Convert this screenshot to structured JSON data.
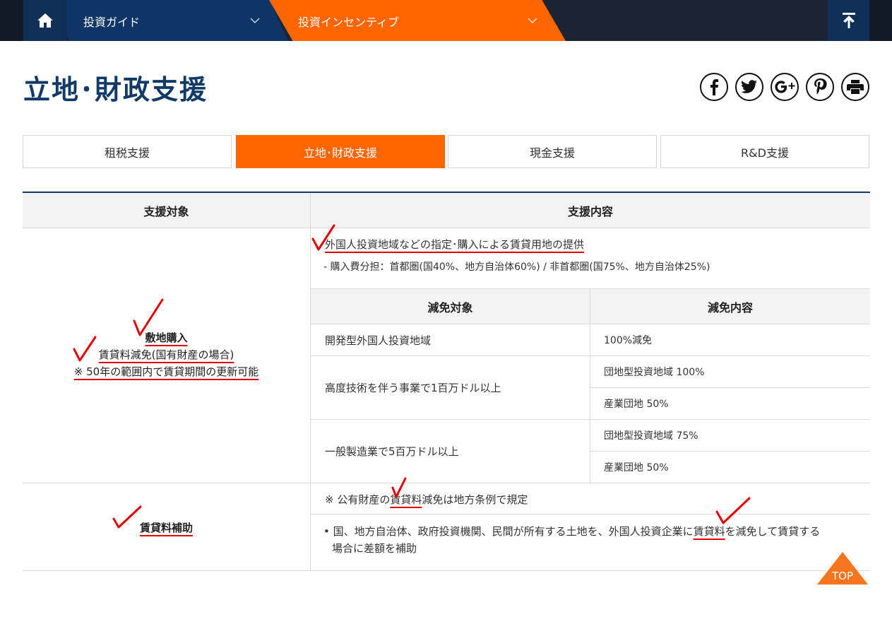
{
  "nav": {
    "guide_label": "投資ガイド",
    "incentive_label": "投資インセンティブ",
    "home_icon": "home-icon",
    "up_icon": "arrow-up-icon",
    "colors": {
      "dark": "#1b2433",
      "navy": "#0e3565",
      "accent": "#ff6600"
    }
  },
  "page": {
    "title": "立地･財政支援"
  },
  "share": [
    "facebook-icon",
    "twitter-icon",
    "google-plus-icon",
    "pinterest-icon",
    "print-icon"
  ],
  "tabs": [
    {
      "label": "租税支援",
      "active": false
    },
    {
      "label": "立地･財政支援",
      "active": true
    },
    {
      "label": "現金支援",
      "active": false
    },
    {
      "label": "R&D支援",
      "active": false
    }
  ],
  "table": {
    "headers": {
      "target": "支援対象",
      "content": "支援内容"
    },
    "land": {
      "title": "敷地購入",
      "line2": "賃貸料減免(国有財産の場合)",
      "line3": "※ 50年の範囲内で賃貸期間の更新可能",
      "intro": "外国人投資地域などの指定･購入による賃貸用地の提供",
      "detail": "- 購入費分担：首都圏(国40%、地方自治体60%) / 非首都圏(国75%、地方自治体25%)",
      "sub_headers": {
        "target": "減免対象",
        "content": "減免内容"
      },
      "rows": [
        {
          "target": "開発型外国人投資地域",
          "items": [
            "100%減免"
          ]
        },
        {
          "target": "高度技術を伴う事業で1百万ドル以上",
          "items": [
            "団地型投資地域 100%",
            "産業団地 50%"
          ]
        },
        {
          "target": "一般製造業で5百万ドル以上",
          "items": [
            "団地型投資地域 75%",
            "産業団地 50%"
          ]
        }
      ]
    },
    "rent": {
      "title": "賃貸料補助",
      "note_pre": "※ 公有財産の",
      "note_hl": "賃貸料",
      "note_post": "減免は地方条例で規定",
      "bullet_pre": "• 国、地方自治体、政府投資機関、民間が所有する土地を、外国人投資企業に",
      "bullet_hl": "賃貸料",
      "bullet_post": "を減免して賃貸する",
      "bullet_line2": "場合に差額を補助"
    }
  },
  "top_button": {
    "label": "TOP"
  }
}
